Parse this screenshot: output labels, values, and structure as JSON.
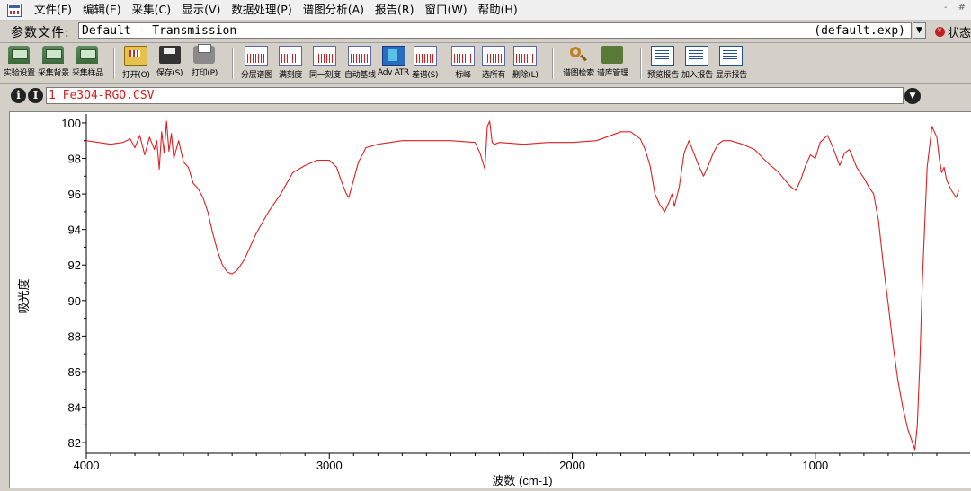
{
  "menu": {
    "items": [
      "文件(F)",
      "编辑(E)",
      "采集(C)",
      "显示(V)",
      "数据处理(P)",
      "谱图分析(A)",
      "报告(R)",
      "窗口(W)",
      "帮助(H)"
    ],
    "window_controls": [
      "-",
      "#"
    ]
  },
  "param": {
    "label": "参数文件:",
    "name": "Default - Transmission",
    "exp": "(default.exp)",
    "status_label": "状态"
  },
  "toolbar": {
    "items": [
      {
        "label": "实验设置",
        "icon": "experiment-setup-icon"
      },
      {
        "label": "采集背景",
        "icon": "collect-background-icon"
      },
      {
        "label": "采集样品",
        "icon": "collect-sample-icon"
      },
      {
        "label": "打开(O)",
        "icon": "open-folder-icon"
      },
      {
        "label": "保存(S)",
        "icon": "save-disk-icon"
      },
      {
        "label": "打印(P)",
        "icon": "printer-icon"
      },
      {
        "label": "分层谱图",
        "icon": "stack-spectra-icon"
      },
      {
        "label": "满刻度",
        "icon": "full-scale-icon"
      },
      {
        "label": "同一刻度",
        "icon": "common-scale-icon"
      },
      {
        "label": "自动基线",
        "icon": "auto-baseline-icon"
      },
      {
        "label": "Adv ATR",
        "icon": "adv-atr-icon"
      },
      {
        "label": "差谱(S)",
        "icon": "subtract-icon"
      },
      {
        "label": "标峰",
        "icon": "find-peaks-icon"
      },
      {
        "label": "选所有",
        "icon": "select-all-icon"
      },
      {
        "label": "删除(L)",
        "icon": "delete-icon"
      },
      {
        "label": "谱图检索",
        "icon": "search-spectra-icon"
      },
      {
        "label": "谱库管理",
        "icon": "library-manager-icon"
      },
      {
        "label": "预览报告",
        "icon": "preview-report-icon"
      },
      {
        "label": "加入报告",
        "icon": "add-to-report-icon"
      },
      {
        "label": "显示报告",
        "icon": "show-report-icon"
      }
    ]
  },
  "file_selector": {
    "info_glyph": "i",
    "next_glyph": "I",
    "value": "1 Fe3O4-RGO.CSV",
    "drop_glyph": "▼"
  },
  "chart_data": {
    "type": "line",
    "title": "",
    "xlabel": "波数 (cm-1)",
    "ylabel": "吸光度",
    "xlim": [
      4000,
      400
    ],
    "ylim": [
      81.5,
      100.3
    ],
    "x_ticks": [
      4000,
      3000,
      2000,
      1000
    ],
    "y_ticks": [
      82,
      84,
      86,
      88,
      90,
      92,
      94,
      96,
      98,
      100
    ],
    "grid": false,
    "series": [
      {
        "color": "#e02020",
        "x": [
          4000,
          3900,
          3850,
          3820,
          3800,
          3780,
          3760,
          3740,
          3720,
          3710,
          3700,
          3690,
          3680,
          3670,
          3660,
          3650,
          3640,
          3620,
          3600,
          3580,
          3560,
          3540,
          3520,
          3500,
          3480,
          3460,
          3440,
          3420,
          3400,
          3380,
          3350,
          3300,
          3250,
          3200,
          3150,
          3100,
          3050,
          3000,
          2970,
          2950,
          2930,
          2920,
          2900,
          2880,
          2860,
          2850,
          2800,
          2700,
          2600,
          2500,
          2400,
          2380,
          2360,
          2350,
          2340,
          2330,
          2320,
          2300,
          2200,
          2100,
          2000,
          1900,
          1800,
          1760,
          1720,
          1700,
          1680,
          1660,
          1640,
          1620,
          1600,
          1590,
          1580,
          1560,
          1540,
          1520,
          1500,
          1480,
          1460,
          1440,
          1420,
          1400,
          1380,
          1350,
          1300,
          1250,
          1200,
          1150,
          1120,
          1100,
          1080,
          1060,
          1040,
          1020,
          1000,
          980,
          950,
          930,
          900,
          880,
          860,
          850,
          830,
          800,
          780,
          760,
          740,
          720,
          700,
          680,
          660,
          640,
          620,
          600,
          590,
          580,
          570,
          560,
          540,
          520,
          500,
          490,
          480,
          470,
          460,
          440,
          420,
          410
        ],
        "y": [
          99.0,
          98.8,
          98.9,
          99.1,
          98.6,
          99.3,
          98.2,
          99.2,
          98.5,
          99.0,
          97.4,
          99.5,
          98.3,
          100.1,
          98.4,
          99.4,
          98.0,
          99.0,
          97.8,
          97.5,
          96.6,
          96.3,
          95.8,
          95.0,
          93.8,
          92.8,
          92.0,
          91.6,
          91.5,
          91.7,
          92.3,
          93.8,
          95.0,
          96.0,
          97.2,
          97.6,
          97.9,
          97.9,
          97.5,
          96.7,
          96.0,
          95.8,
          96.8,
          97.8,
          98.3,
          98.6,
          98.8,
          99.0,
          99.0,
          99.0,
          98.9,
          98.3,
          97.4,
          99.8,
          100.1,
          98.9,
          98.8,
          98.9,
          98.8,
          98.9,
          98.9,
          99.0,
          99.5,
          99.5,
          99.1,
          98.5,
          97.6,
          96.0,
          95.4,
          95.0,
          95.6,
          96.0,
          95.3,
          96.4,
          98.3,
          99.0,
          98.3,
          97.6,
          97.0,
          97.6,
          98.3,
          98.8,
          99.0,
          99.0,
          98.8,
          98.5,
          97.8,
          97.2,
          96.7,
          96.4,
          96.2,
          96.8,
          97.6,
          98.2,
          98.0,
          98.9,
          99.3,
          98.7,
          97.6,
          98.3,
          98.5,
          98.2,
          97.5,
          96.9,
          96.4,
          96.0,
          94.5,
          92.0,
          89.8,
          87.5,
          85.5,
          84.0,
          82.8,
          82.0,
          81.6,
          83.0,
          86.5,
          91.0,
          97.5,
          99.8,
          99.2,
          98.0,
          97.2,
          97.5,
          96.8,
          96.2,
          95.8,
          96.2
        ]
      }
    ]
  }
}
